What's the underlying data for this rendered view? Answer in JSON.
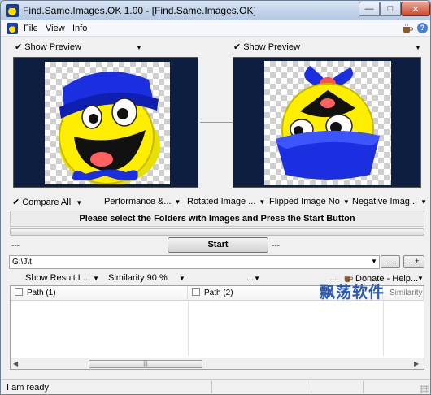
{
  "window": {
    "title": "Find.Same.Images.OK 1.00 - [Find.Same.Images.OK]"
  },
  "menu": {
    "file": "File",
    "view": "View",
    "info": "Info"
  },
  "preview": {
    "left_label": "Show Preview",
    "right_label": "Show Preview"
  },
  "options": {
    "compare_all": "Compare All",
    "performance": "Performance &...",
    "rotated": "Rotated Image ...",
    "flipped": "Flipped Image No",
    "negative": "Negative Imag..."
  },
  "status_message": "Please select the Folders with Images and Press the Start Button",
  "start": {
    "label": "Start",
    "dashes": "---"
  },
  "path": {
    "value": "G:\\J\\t",
    "browse_label": "...",
    "add_label": "...+"
  },
  "results": {
    "show_result": "Show Result L...",
    "similarity": "Similarity 90 %",
    "dots": "...",
    "donate": "Donate - Help..."
  },
  "table": {
    "columns": [
      "Path (1)",
      "Path (2)",
      "Similarity"
    ]
  },
  "watermark": "飘荡软件",
  "statusbar": {
    "text": "I am ready"
  }
}
